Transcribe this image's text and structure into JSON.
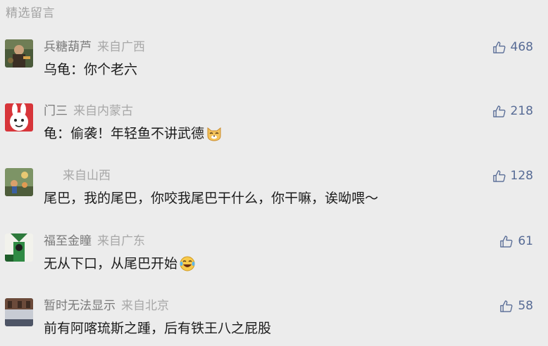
{
  "section": {
    "title": "精选留言"
  },
  "comments": [
    {
      "name": "兵糖葫芦",
      "location": "来自广西",
      "content": "乌龟：你个老六",
      "likes": "468",
      "emoji": ""
    },
    {
      "name": "门三",
      "location": "来自内蒙古",
      "content": "龟：偷袭！年轻鱼不讲武德",
      "likes": "218",
      "emoji": "cat-face-emoji"
    },
    {
      "name": "",
      "location": "来自山西",
      "content": "尾巴，我的尾巴，你咬我尾巴干什么，你干嘛，诶呦喂～",
      "likes": "128",
      "emoji": ""
    },
    {
      "name": "福至金瞳",
      "location": "来自广东",
      "content": "无从下口，从尾巴开始",
      "likes": "61",
      "emoji": "tears-of-joy-emoji"
    },
    {
      "name": "暂时无法显示",
      "location": "来自北京",
      "content": "前有阿喀琉斯之踵，后有铁王八之屁股",
      "likes": "58",
      "emoji": ""
    }
  ],
  "icons": {
    "like": "thumbs-up-icon"
  },
  "colors": {
    "background": "#ececec",
    "link": "#576b95",
    "muted": "#a8a8a8",
    "text": "#1b1b1b"
  }
}
